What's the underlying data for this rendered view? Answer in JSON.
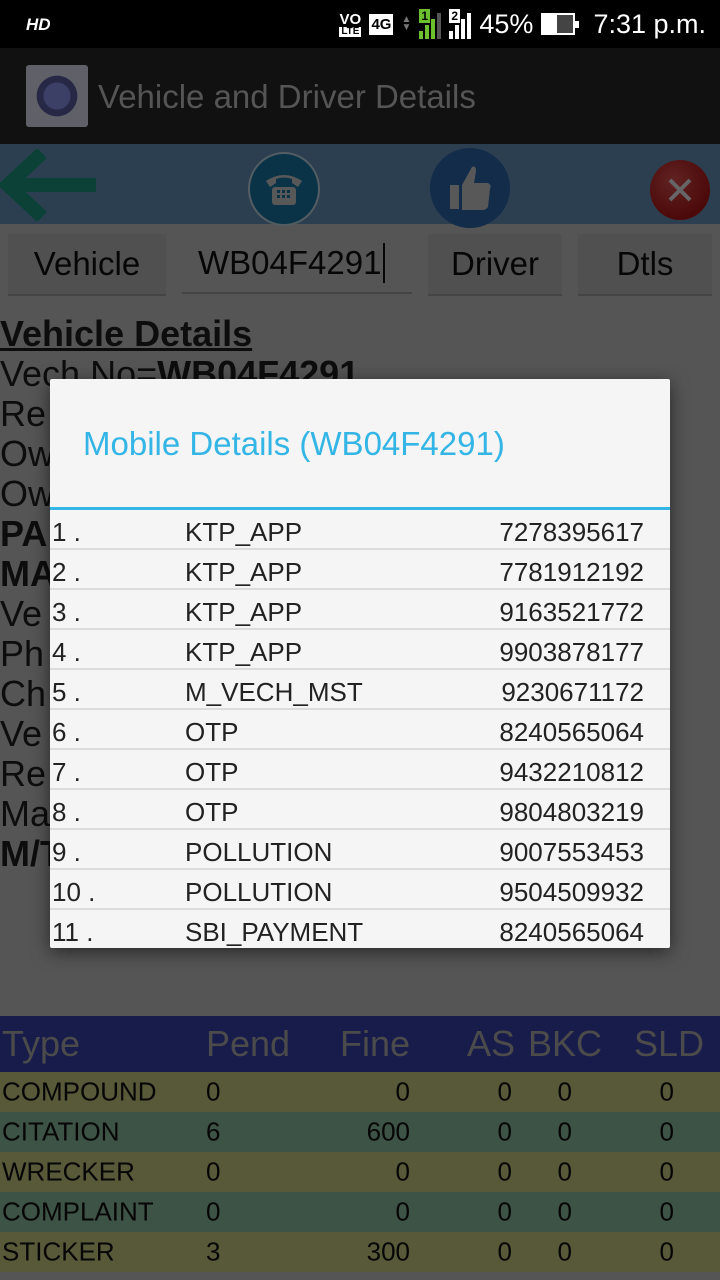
{
  "status_bar": {
    "hd_label": "HD",
    "volte_top": "VO",
    "volte_bottom": "LTE",
    "network_type": "4G",
    "sim1_label": "1",
    "sim2_label": "2",
    "battery_percent": "45%",
    "battery_level": 0.45,
    "time": "7:31 p.m."
  },
  "app_bar": {
    "title": "Vehicle and Driver Details",
    "logo_icon": "police-emblem-icon"
  },
  "toolbar": {
    "back_icon": "back-arrow-icon",
    "call_icon": "telephone-icon",
    "like_icon": "thumbs-up-icon",
    "close_icon": "close-icon",
    "colors": {
      "back_arrow": "#1fa389",
      "close": "#d32020",
      "call": "#1b7fb3",
      "like": "#2e6fb8"
    }
  },
  "search_row": {
    "vehicle_button": "Vehicle",
    "vehicle_input_value": "WB04F4291",
    "driver_button": "Driver",
    "details_button": "Dtls"
  },
  "background_details": {
    "heading": "Vehicle Details",
    "lines": [
      {
        "prefix": "Vech No=",
        "bold": "WB04F4291"
      },
      {
        "prefix": "Re",
        "bold": ""
      },
      {
        "prefix": "Ow",
        "bold": ""
      },
      {
        "prefix": "Ow",
        "bold": ""
      },
      {
        "prefix": "",
        "bold": "PA"
      },
      {
        "prefix": "",
        "bold": "MA"
      },
      {
        "prefix": "Ve",
        "bold": ""
      },
      {
        "prefix": "Ph",
        "bold": ""
      },
      {
        "prefix": "Ch",
        "bold": ""
      },
      {
        "prefix": "Ve",
        "bold": ""
      },
      {
        "prefix": "Re",
        "bold": ""
      },
      {
        "prefix": "Ma",
        "bold": ""
      },
      {
        "prefix": "",
        "bold": "M/TAXI,Boin"
      }
    ]
  },
  "dialog": {
    "title": "Mobile Details (WB04F4291)",
    "accent_color": "#33b5e5",
    "rows": [
      {
        "index": "1 .",
        "source": "KTP_APP",
        "mobile": "7278395617"
      },
      {
        "index": "2 .",
        "source": "KTP_APP",
        "mobile": "7781912192"
      },
      {
        "index": "3 .",
        "source": "KTP_APP",
        "mobile": "9163521772"
      },
      {
        "index": "4 .",
        "source": "KTP_APP",
        "mobile": "9903878177"
      },
      {
        "index": "5 .",
        "source": "M_VECH_MST",
        "mobile": "9230671172"
      },
      {
        "index": "6 .",
        "source": "OTP",
        "mobile": "8240565064"
      },
      {
        "index": "7 .",
        "source": "OTP",
        "mobile": "9432210812"
      },
      {
        "index": "8 .",
        "source": "OTP",
        "mobile": "9804803219"
      },
      {
        "index": "9 .",
        "source": "POLLUTION",
        "mobile": "9007553453"
      },
      {
        "index": "10 .",
        "source": "POLLUTION",
        "mobile": "9504509932"
      },
      {
        "index": "11 .",
        "source": "SBI_PAYMENT",
        "mobile": "8240565064"
      }
    ]
  },
  "case_table": {
    "headers": {
      "type": "Type",
      "pend": "Pend",
      "fine": "Fine",
      "as": "AS",
      "bkc": "BKC",
      "sld": "SLD"
    },
    "rows": [
      {
        "type": "COMPOUND",
        "pend": "0",
        "fine": "0",
        "as": "0",
        "bkc": "0",
        "sld": "0"
      },
      {
        "type": "CITATION",
        "pend": "6",
        "fine": "600",
        "as": "0",
        "bkc": "0",
        "sld": "0"
      },
      {
        "type": "WRECKER",
        "pend": "0",
        "fine": "0",
        "as": "0",
        "bkc": "0",
        "sld": "0"
      },
      {
        "type": "COMPLAINT",
        "pend": "0",
        "fine": "0",
        "as": "0",
        "bkc": "0",
        "sld": "0"
      },
      {
        "type": "STICKER",
        "pend": "3",
        "fine": "300",
        "as": "0",
        "bkc": "0",
        "sld": "0"
      }
    ]
  }
}
